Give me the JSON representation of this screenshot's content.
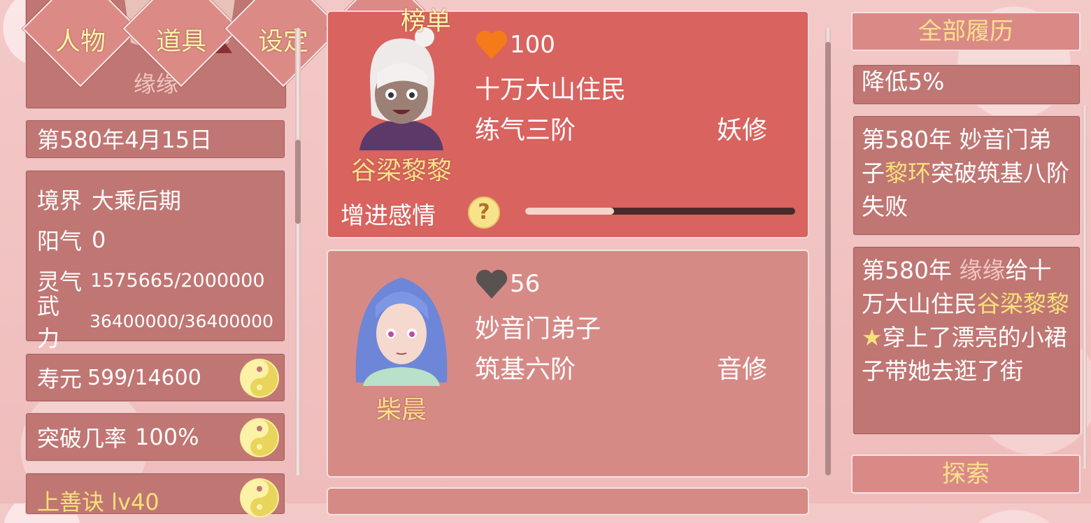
{
  "nav": {
    "tabs": [
      {
        "label": "人物"
      },
      {
        "label": "道具"
      },
      {
        "label": "设定"
      },
      {
        "label": "榜单"
      }
    ]
  },
  "player": {
    "name": "缘缘",
    "date": "第580年4月15日",
    "realm_label": "境界",
    "realm_value": "大乘后期",
    "yang_label": "阳气",
    "yang_value": "0",
    "qi_label": "灵气",
    "qi_value": "1575665/2000000",
    "force_label": "武力",
    "force_value": "36400000/36400000",
    "lifespan_label": "寿元",
    "lifespan_value": "599/14600",
    "breakthrough_label": "突破几率",
    "breakthrough_value": "100%",
    "skill": "上善诀 lv40"
  },
  "characters": [
    {
      "name": "谷梁黎黎",
      "affection": "100",
      "heart_color": "#f47a1a",
      "identity": "十万大山住民",
      "realm": "练气三阶",
      "type": "妖修",
      "affection_label": "增进感情",
      "help": "?",
      "progress": 0.33
    },
    {
      "name": "柴晨",
      "affection": "56",
      "heart_color": "#5a5250",
      "identity": "妙音门弟子",
      "realm": "筑基六阶",
      "type": "音修"
    }
  ],
  "history": {
    "button": "全部履历",
    "partial": "降低5%",
    "log1": {
      "a": "第580年 妙音门弟子",
      "b": "黎环",
      "c": "突破筑基八阶失败"
    },
    "log2": {
      "a": "第580年 ",
      "b": "缘缘",
      "c": "给十万大山住民",
      "d": "谷梁黎黎★",
      "e": "穿上了漂亮的小裙子带她去逛了街"
    }
  },
  "explore": {
    "label": "探索"
  },
  "colors": {
    "accent_yellow": "#fde08a",
    "panel": "#c07673",
    "card_active": "#d8635f"
  }
}
